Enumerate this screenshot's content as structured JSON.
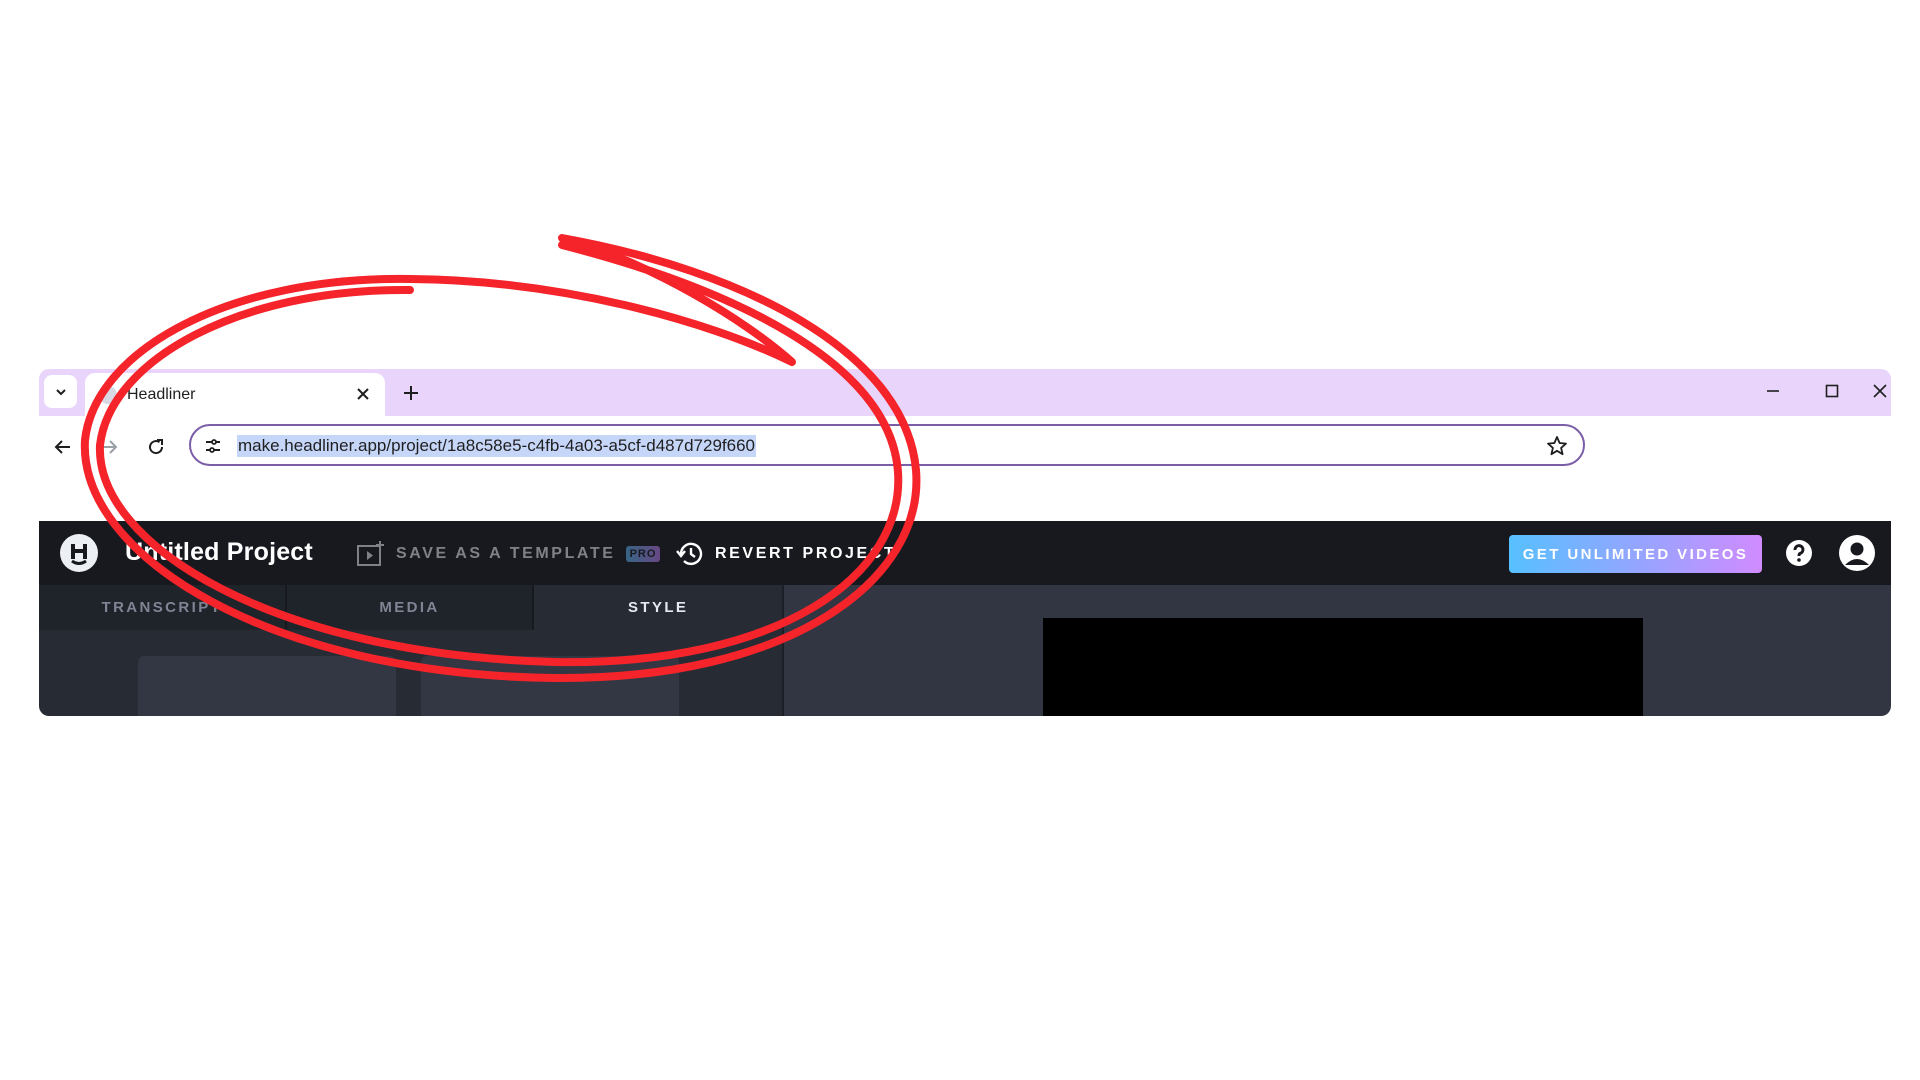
{
  "browser": {
    "tab_title": "Headliner",
    "url": "make.headliner.app/project/1a8c58e5-c4fb-4a03-a5cf-d487d729f660",
    "tabstrip_color": "#e9d5fb",
    "omnibox_border_color": "#7b5ea7"
  },
  "app": {
    "project_title": "Untitled Project",
    "save_template_label": "SAVE AS A TEMPLATE",
    "pro_badge": "PRO",
    "revert_label": "REVERT PROJECT",
    "cta_label": "GET UNLIMITED VIDEOS",
    "cta_gradient": [
      "#57c0ff",
      "#d08bff"
    ],
    "header_color": "#17191f",
    "tabs": [
      {
        "label": "TRANSCRIPT",
        "active": false
      },
      {
        "label": "MEDIA",
        "active": false
      },
      {
        "label": "STYLE",
        "active": true
      }
    ]
  },
  "annotation": {
    "shape": "hand-drawn circle",
    "color": "#f5242b"
  },
  "icons": {
    "tab_menu": "chevron-down-icon",
    "favicon": "favicon-icon",
    "tab_close": "close-icon",
    "new_tab": "plus-icon",
    "minimize": "minimize-icon",
    "maximize": "maximize-icon",
    "close_window": "close-icon",
    "back": "arrow-left-icon",
    "forward": "arrow-right-icon",
    "reload": "reload-icon",
    "site_info": "tune-icon",
    "bookmark": "star-icon",
    "logo": "headliner-logo-icon",
    "save_template": "template-icon",
    "revert": "history-icon",
    "help": "help-icon",
    "account": "account-icon"
  }
}
